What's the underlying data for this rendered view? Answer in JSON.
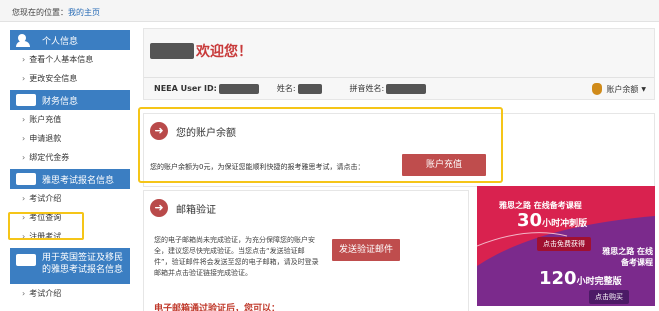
{
  "breadcrumb": {
    "prefix": "您现在的位置：",
    "link": "我的主页"
  },
  "sidebar": {
    "sections": [
      {
        "title": "个人信息",
        "items": [
          "查看个人基本信息",
          "更改安全信息"
        ]
      },
      {
        "title": "财务信息",
        "items": [
          "账户充值",
          "申请退款",
          "绑定代金券"
        ]
      },
      {
        "title": "雅思考试报名信息",
        "items": [
          "考试介绍",
          "考位查询",
          "注册考试"
        ]
      },
      {
        "title": "用于英国签证及移民的雅思考试报名信息",
        "items": [
          "考试介绍"
        ]
      }
    ]
  },
  "header": {
    "welcome": "欢迎您！",
    "user_id_label": "NEEA User ID:",
    "name_label": "姓名:",
    "pinyin_label": "拼音姓名:",
    "account_menu": "账户余额"
  },
  "balance": {
    "title": "您的账户余额",
    "text": "您的账户余额为0元，为保证您能顺利快捷的报考雅思考试，请点击：",
    "button": "账户充值"
  },
  "email": {
    "title": "邮箱验证",
    "text": "您的电子邮箱尚未完成验证，为充分保障您的账户安全，建议您尽快完成验证。当您点击“发送验证邮件”，验证邮件将会发送至您的电子邮箱，请及时登录邮箱并点击验证链接完成验证。",
    "button": "发送验证邮件",
    "footer": "电子邮箱通过验证后，您可以："
  },
  "ad": {
    "brand1": "雅思之路 在线备考课程",
    "hours1": "30",
    "unit1": "小时冲刺版",
    "cta1": "点击免费获得",
    "brand2": "雅思之路 在线备考课程",
    "hours2": "120",
    "unit2": "小时完整版",
    "cta2": "点击购买"
  },
  "colors": {
    "accent": "#3b7ec2",
    "button": "#bf4d4d",
    "highlight": "#f5c518"
  }
}
